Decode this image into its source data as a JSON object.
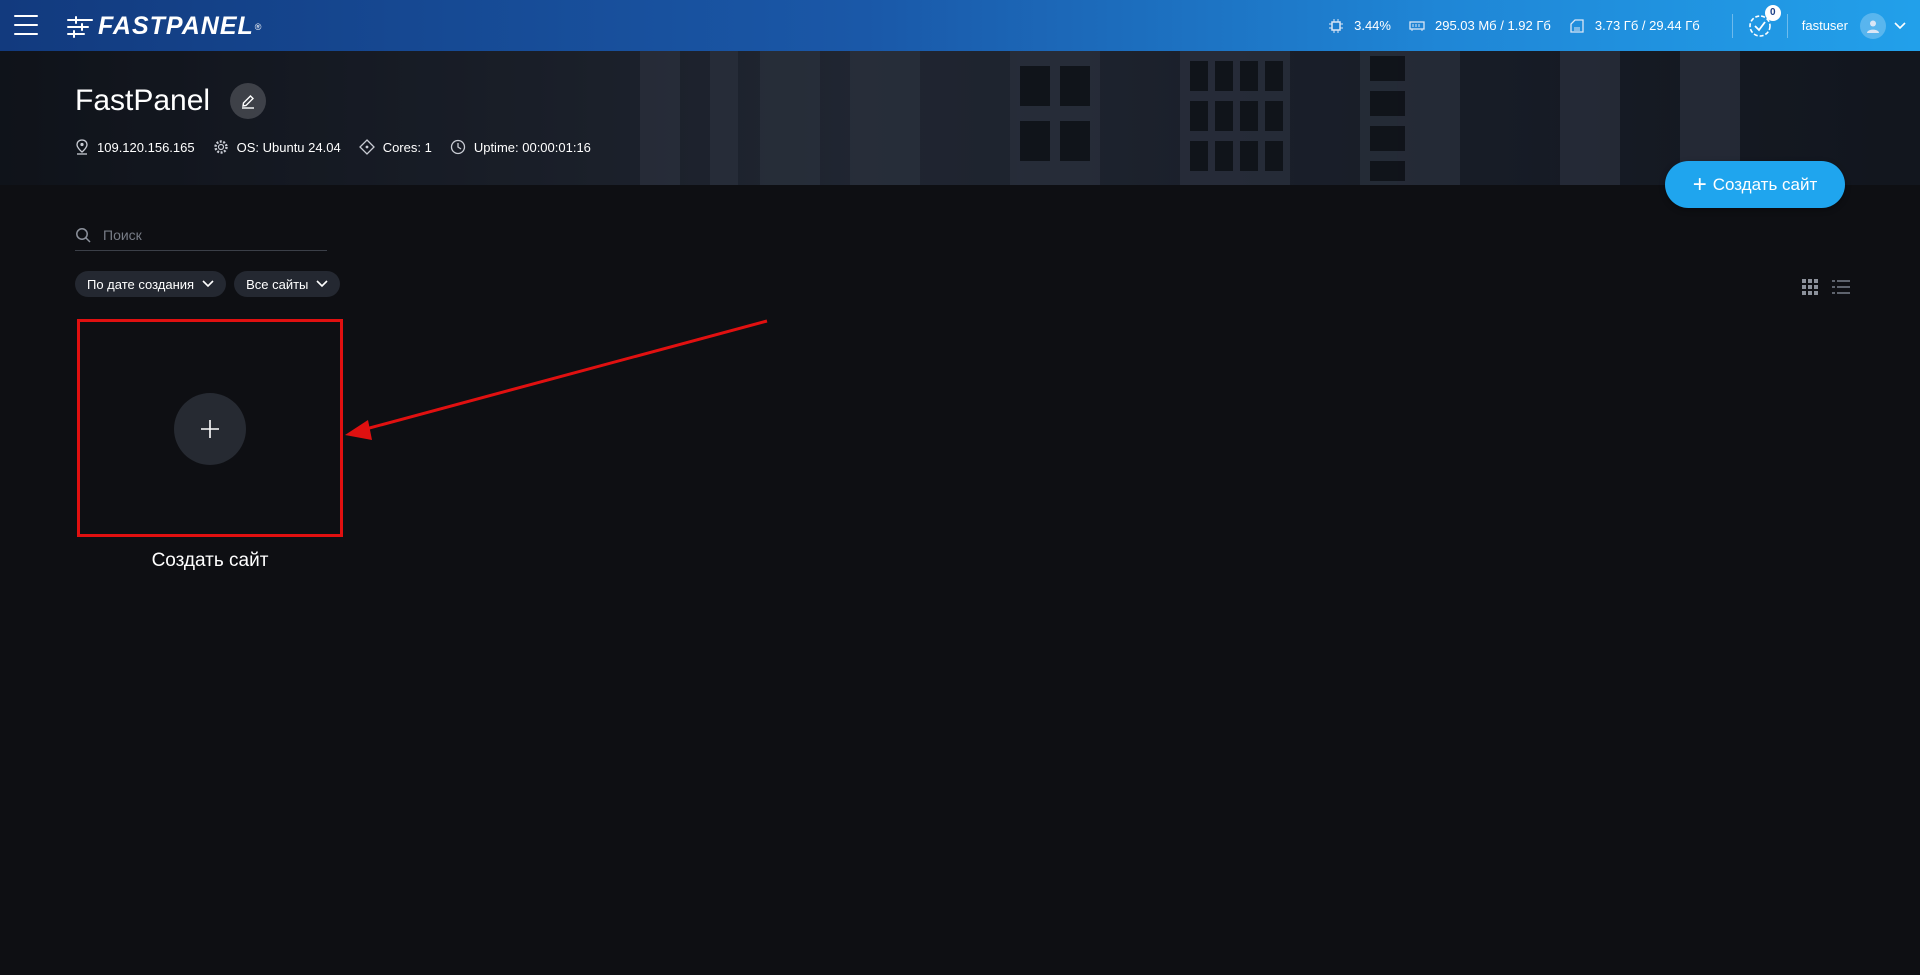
{
  "app": {
    "logo": "FASTPANEL",
    "logo_reg": "®"
  },
  "topbar": {
    "cpu": "3.44%",
    "ram": "295.03 Мб / 1.92 Гб",
    "disk": "3.73 Гб / 29.44 Гб",
    "tasks_count": "0",
    "username": "fastuser"
  },
  "server": {
    "name": "FastPanel",
    "ip": "109.120.156.165",
    "os": "OS: Ubuntu 24.04",
    "cores": "Cores: 1",
    "uptime": "Uptime: 00:00:01:16"
  },
  "actions": {
    "create_site": "Создать сайт"
  },
  "search": {
    "placeholder": "Поиск"
  },
  "filters": {
    "sort": "По дате создания",
    "scope": "Все сайты"
  },
  "create_card": {
    "label": "Создать сайт"
  },
  "colors": {
    "accent": "#1fa5ee",
    "highlight": "#e01010",
    "background": "#0e0f13"
  }
}
